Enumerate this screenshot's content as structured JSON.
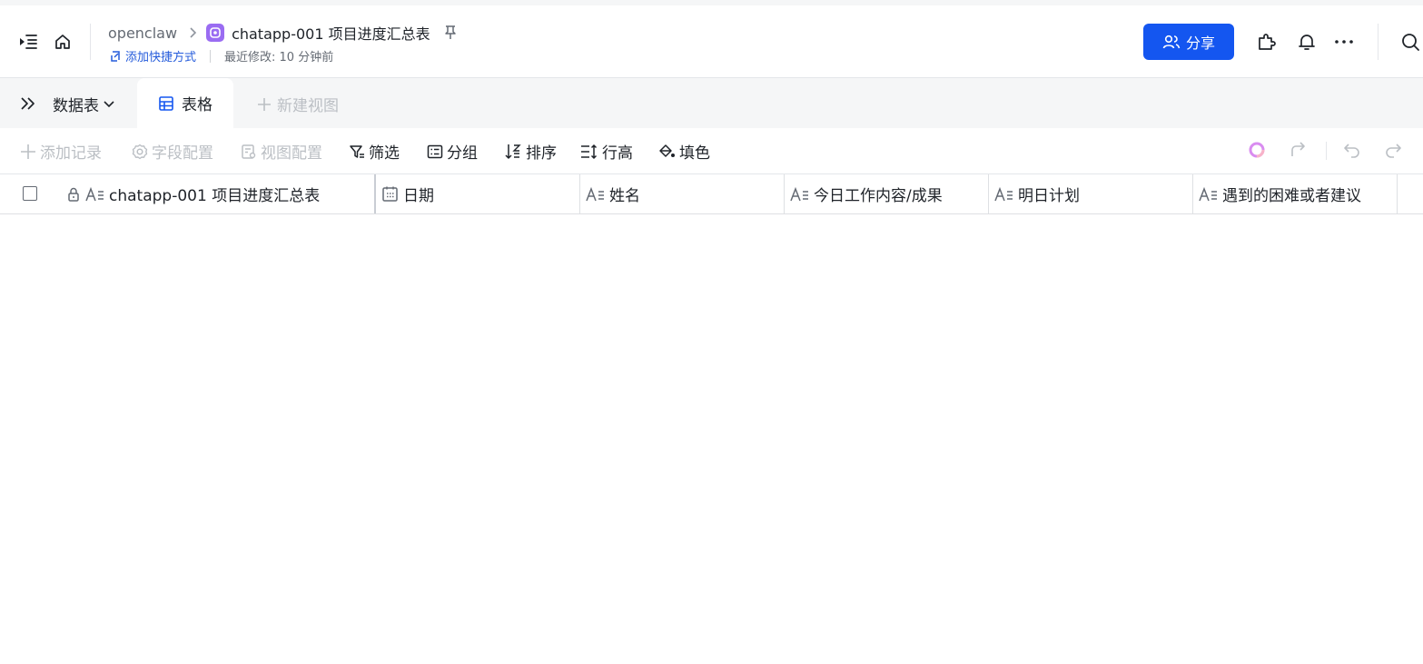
{
  "header": {
    "breadcrumb_root": "openclaw",
    "doc_title": "chatapp-001 项目进度汇总表",
    "add_shortcut": "添加快捷方式",
    "last_modified": "最近修改: 10 分钟前",
    "share_label": "分享"
  },
  "tabbar": {
    "datasheet_label": "数据表",
    "active_view": "表格",
    "new_view": "新建视图"
  },
  "toolbar": {
    "add_record": "添加记录",
    "field_config": "字段配置",
    "view_config": "视图配置",
    "filter": "筛选",
    "group": "分组",
    "sort": "排序",
    "row_height": "行高",
    "fill_color": "填色"
  },
  "grid": {
    "columns": [
      "chatapp-001 项目进度汇总表",
      "日期",
      "姓名",
      "今日工作内容/成果",
      "明日计划",
      "遇到的困难或者建议"
    ]
  },
  "colors": {
    "accent": "#1456f0",
    "app_icon": "#9a6cf2",
    "disabled_text": "#bbbfc4"
  }
}
